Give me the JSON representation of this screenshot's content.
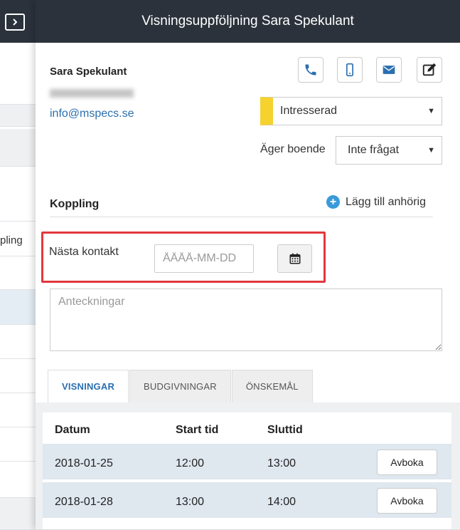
{
  "background": {
    "strip_label": "pling"
  },
  "panel": {
    "title": "Visningsuppföljning Sara Spekulant"
  },
  "contact": {
    "name": "Sara Spekulant",
    "email": "info@mspecs.se"
  },
  "actions": [
    {
      "icon": "phone-icon"
    },
    {
      "icon": "mobile-icon"
    },
    {
      "icon": "envelope-icon"
    },
    {
      "icon": "edit-icon"
    }
  ],
  "status": {
    "value": "Intresserad",
    "color": "#f5d22e"
  },
  "owns_home": {
    "label": "Äger boende",
    "value": "Inte frågat"
  },
  "relation": {
    "label": "Koppling",
    "add_label": "Lägg till anhörig"
  },
  "next_contact": {
    "label": "Nästa kontakt",
    "placeholder": "ÅÅÅÅ-MM-DD"
  },
  "notes": {
    "placeholder": "Anteckningar"
  },
  "tabs": [
    {
      "label": "VISNINGAR",
      "active": true
    },
    {
      "label": "BUDGIVNINGAR",
      "active": false
    },
    {
      "label": "ÖNSKEMÅL",
      "active": false
    }
  ],
  "showings": {
    "columns": [
      "Datum",
      "Start tid",
      "Sluttid"
    ],
    "rows": [
      {
        "date": "2018-01-25",
        "start": "12:00",
        "end": "13:00",
        "action": "Avboka"
      },
      {
        "date": "2018-01-28",
        "start": "13:00",
        "end": "14:00",
        "action": "Avboka"
      }
    ]
  },
  "colors": {
    "header_bg": "#2b323b",
    "accent_link": "#2a6fb0",
    "highlight_border": "#e2383c",
    "row_bg": "#dfe7ef",
    "add_icon": "#3a9ad9"
  }
}
